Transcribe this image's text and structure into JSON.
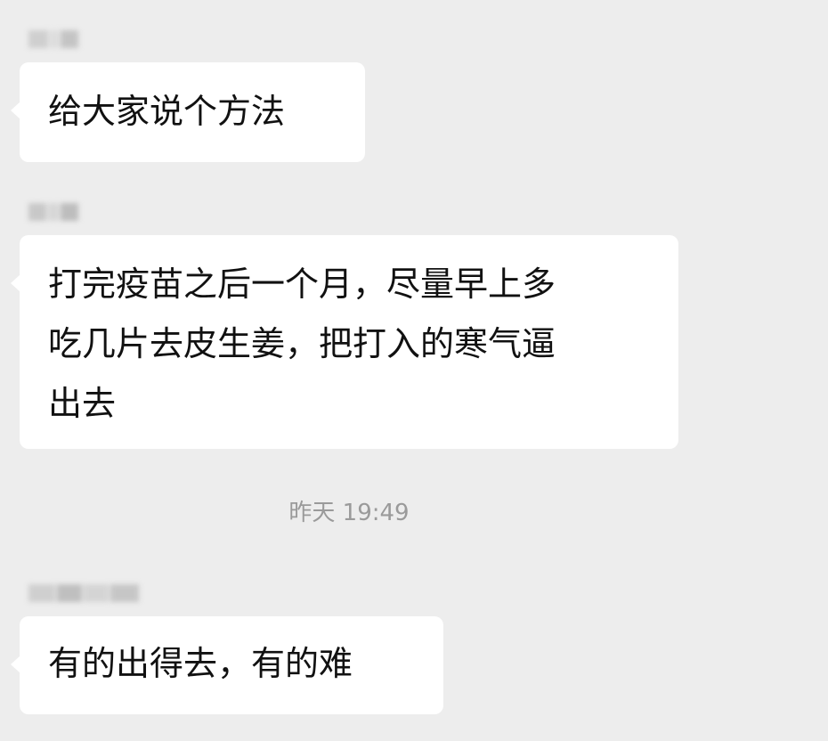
{
  "colors": {
    "background": "#ededed",
    "bubble": "#ffffff",
    "text": "#111111",
    "timestamp": "#9a9a9a"
  },
  "messages": [
    {
      "lines": [
        "给大家说个方法"
      ]
    },
    {
      "lines": [
        "打完疫苗之后一个月，尽量早上多",
        "吃几片去皮生姜，把打入的寒气逼",
        "出去"
      ]
    },
    {
      "lines": [
        "有的出得去，有的难"
      ]
    }
  ],
  "timestamp": "昨天 19:49"
}
